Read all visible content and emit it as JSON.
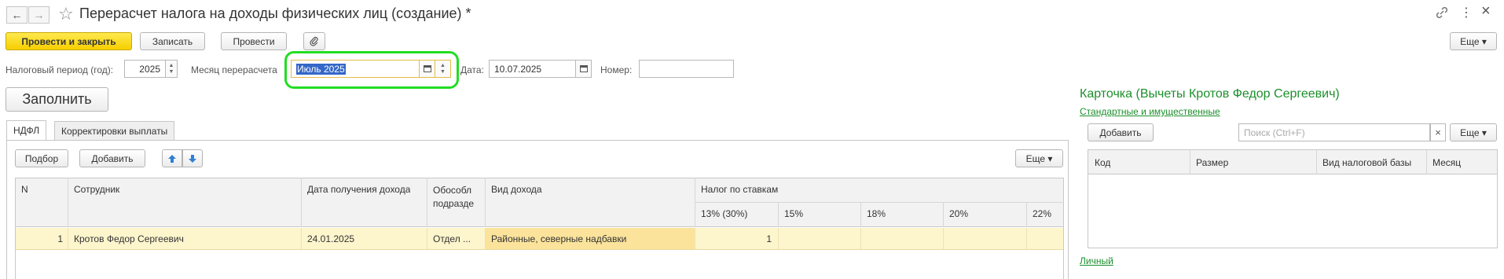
{
  "window": {
    "title": "Перерасчет налога на доходы физических лиц (создание) *",
    "back_icon": "←",
    "forward_icon": "→",
    "star_icon": "☆",
    "link_icon": "🔗",
    "menu_icon": "⋮",
    "close_icon": "×"
  },
  "toolbar": {
    "post_close_label": "Провести и закрыть",
    "save_label": "Записать",
    "post_label": "Провести",
    "more_label": "Еще ▾"
  },
  "form": {
    "tax_period_label": "Налоговый период (год):",
    "tax_period_value": "2025",
    "month_label": "Месяц перерасчета",
    "month_value": "Июль 2025",
    "date_label": "Дата:",
    "date_value": "10.07.2025",
    "number_label": "Номер:",
    "number_value": "",
    "fill_label": "Заполнить"
  },
  "tabs": [
    {
      "label": "НДФЛ",
      "active": true
    },
    {
      "label": "Корректировки выплаты",
      "active": false
    }
  ],
  "grid_toolbar": {
    "select_label": "Подбор",
    "add_label": "Добавить",
    "more_label": "Еще ▾"
  },
  "grid": {
    "headers": {
      "n": "N",
      "employee": "Сотрудник",
      "income_date": "Дата получения дохода",
      "division": "Обособл подразде",
      "income_type": "Вид дохода",
      "tax_by_rates": "Налог по ставкам",
      "rate_13": "13% (30%)",
      "rate_15": "15%",
      "rate_18": "18%",
      "rate_20": "20%",
      "rate_22": "22%"
    },
    "rows": [
      {
        "n": "1",
        "employee": "Кротов Федор Сергеевич",
        "income_date": "24.01.2025",
        "division": "Отдел ...",
        "income_type": "Районные, северные надбавки",
        "rate_13": "1",
        "rate_15": "",
        "rate_18": "",
        "rate_20": "",
        "rate_22": ""
      }
    ]
  },
  "card": {
    "title": "Карточка (Вычеты Кротов Федор Сергеевич)",
    "link_standard": "Стандартные и имущественные",
    "add_label": "Добавить",
    "search_placeholder": "Поиск (Ctrl+F)",
    "more_label": "Еще ▾",
    "columns": [
      "Код",
      "Размер",
      "Вид налоговой базы",
      "Месяц"
    ],
    "link_personal": "Личный"
  },
  "colors": {
    "highlight_ring": "#22dd22",
    "selected_row": "#fdf5cc",
    "selected_cell": "#fbe39b",
    "link_green": "#1c8f2c",
    "primary_button": "#f6cf00"
  }
}
